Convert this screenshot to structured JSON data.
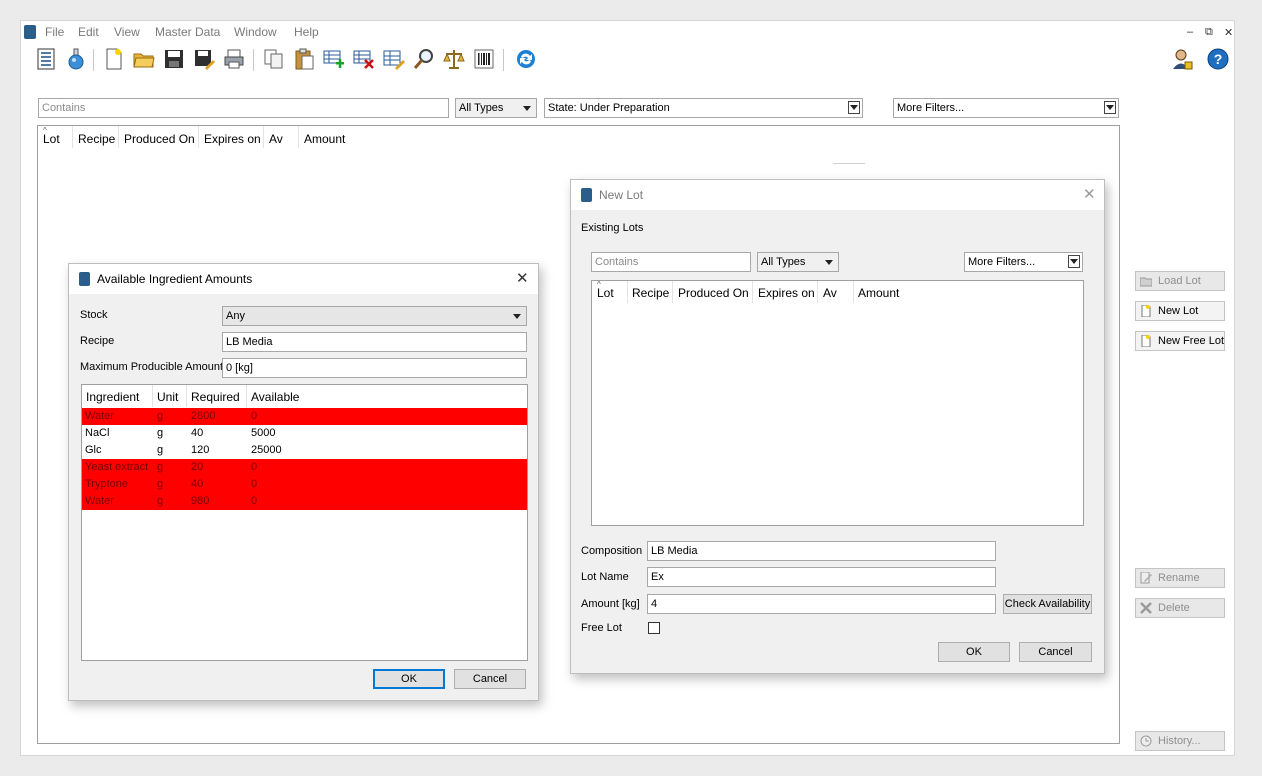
{
  "menubar": {
    "items": [
      "File",
      "Edit",
      "View",
      "Master Data",
      "Window",
      "Help"
    ]
  },
  "filters": {
    "contains_placeholder": "Contains",
    "type": "All Types",
    "state": "State: Under Preparation",
    "more": "More Filters..."
  },
  "main_table": {
    "columns": [
      "Lot",
      "Recipe",
      "Produced On",
      "Expires on",
      "Av",
      "Amount"
    ]
  },
  "side_buttons": {
    "load_lot": "Load Lot",
    "new_lot": "New Lot",
    "new_free_lot": "New Free Lot",
    "rename": "Rename",
    "delete": "Delete",
    "history": "History..."
  },
  "ingredients_dialog": {
    "title": "Available Ingredient Amounts",
    "stock_label": "Stock",
    "stock_value": "Any",
    "recipe_label": "Recipe",
    "recipe_value": "LB Media",
    "max_label": "Maximum Producible Amount",
    "max_value": "0 [kg]",
    "columns": [
      "Ingredient",
      "Unit",
      "Required",
      "Available"
    ],
    "rows": [
      {
        "ingredient": "Water",
        "unit": "g",
        "required": "2800",
        "available": "0",
        "insufficient": true
      },
      {
        "ingredient": "NaCl",
        "unit": "g",
        "required": "40",
        "available": "5000",
        "insufficient": false
      },
      {
        "ingredient": "Glc",
        "unit": "g",
        "required": "120",
        "available": "25000",
        "insufficient": false
      },
      {
        "ingredient": "Yeast extract",
        "unit": "g",
        "required": "20",
        "available": "0",
        "insufficient": true
      },
      {
        "ingredient": "Tryptone",
        "unit": "g",
        "required": "40",
        "available": "0",
        "insufficient": true
      },
      {
        "ingredient": "Water",
        "unit": "g",
        "required": "980",
        "available": "0",
        "insufficient": true
      }
    ],
    "ok": "OK",
    "cancel": "Cancel"
  },
  "new_lot_dialog": {
    "title": "New Lot",
    "existing_label": "Existing Lots",
    "contains_placeholder": "Contains",
    "type": "All Types",
    "more": "More Filters...",
    "columns": [
      "Lot",
      "Recipe",
      "Produced On",
      "Expires on",
      "Av",
      "Amount"
    ],
    "composition_label": "Composition",
    "composition_value": "LB Media",
    "lotname_label": "Lot Name",
    "lotname_value": "Ex",
    "amount_label": "Amount [kg]",
    "amount_value": "4",
    "check": "Check Availability",
    "free_label": "Free Lot",
    "ok": "OK",
    "cancel": "Cancel"
  },
  "colors": {
    "insufficient_row": "#ff0000",
    "focus_blue": "#0078d7",
    "brand_icon": "#2b5d8a"
  }
}
